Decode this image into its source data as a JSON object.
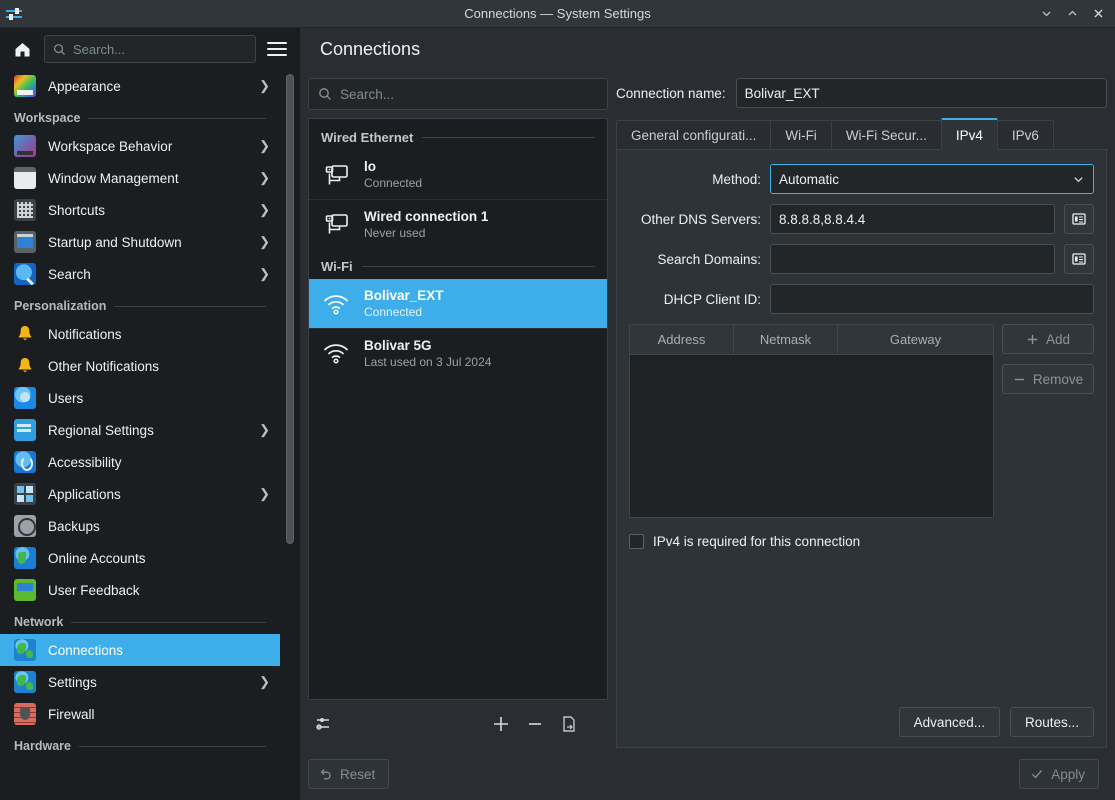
{
  "window": {
    "title": "Connections — System Settings",
    "app_icon": "sliders-icon",
    "controls": {
      "minimize": "minimize-icon",
      "maximize": "maximize-icon",
      "close": "close-icon"
    }
  },
  "sidebar": {
    "home_icon": "home-icon",
    "search": {
      "placeholder": "Search...",
      "value": "",
      "icon": "search-icon"
    },
    "menu_icon": "hamburger-menu-icon",
    "top_items": [
      {
        "label": "Appearance",
        "icon": "appearance-icon",
        "chevron": true,
        "iconclass": "ic-appearance"
      }
    ],
    "groups": [
      {
        "title": "Workspace",
        "items": [
          {
            "label": "Workspace Behavior",
            "icon": "workspace-behavior-icon",
            "chevron": true,
            "iconclass": "ic-wsbehavior"
          },
          {
            "label": "Window Management",
            "icon": "window-management-icon",
            "chevron": true,
            "iconclass": "ic-winmgmt"
          },
          {
            "label": "Shortcuts",
            "icon": "shortcuts-icon",
            "chevron": true,
            "iconclass": "ic-shortcuts"
          },
          {
            "label": "Startup and Shutdown",
            "icon": "startup-shutdown-icon",
            "chevron": true,
            "iconclass": "ic-startup"
          },
          {
            "label": "Search",
            "icon": "search-module-icon",
            "chevron": true,
            "iconclass": "ic-search"
          }
        ]
      },
      {
        "title": "Personalization",
        "items": [
          {
            "label": "Notifications",
            "icon": "bell-icon",
            "chevron": false,
            "iconclass": "ic-bell"
          },
          {
            "label": "Other Notifications",
            "icon": "bell-icon",
            "chevron": false,
            "iconclass": "ic-bell"
          },
          {
            "label": "Users",
            "icon": "users-icon",
            "chevron": false,
            "iconclass": "ic-users"
          },
          {
            "label": "Regional Settings",
            "icon": "regional-settings-icon",
            "chevron": true,
            "iconclass": "ic-regional"
          },
          {
            "label": "Accessibility",
            "icon": "accessibility-icon",
            "chevron": false,
            "iconclass": "ic-access"
          },
          {
            "label": "Applications",
            "icon": "applications-icon",
            "chevron": true,
            "iconclass": "ic-apps"
          },
          {
            "label": "Backups",
            "icon": "backups-icon",
            "chevron": false,
            "iconclass": "ic-backups"
          },
          {
            "label": "Online Accounts",
            "icon": "online-accounts-icon",
            "chevron": false,
            "iconclass": "ic-online"
          },
          {
            "label": "User Feedback",
            "icon": "user-feedback-icon",
            "chevron": false,
            "iconclass": "ic-feedback"
          }
        ]
      },
      {
        "title": "Network",
        "items": [
          {
            "label": "Connections",
            "icon": "globe-icon",
            "chevron": false,
            "selected": true,
            "iconclass": "ic-globe"
          },
          {
            "label": "Settings",
            "icon": "globe-icon",
            "chevron": true,
            "iconclass": "ic-globe"
          },
          {
            "label": "Firewall",
            "icon": "firewall-icon",
            "chevron": false,
            "iconclass": "ic-firewall"
          }
        ]
      },
      {
        "title": "Hardware",
        "items": []
      }
    ]
  },
  "page": {
    "title": "Connections"
  },
  "connections_panel": {
    "search": {
      "placeholder": "Search...",
      "value": "",
      "icon": "search-icon"
    },
    "groups": [
      {
        "title": "Wired Ethernet",
        "items": [
          {
            "name": "lo",
            "status": "Connected",
            "icon": "wired-network-icon",
            "selected": false
          },
          {
            "name": "Wired connection 1",
            "status": "Never used",
            "icon": "wired-network-icon",
            "selected": false
          }
        ]
      },
      {
        "title": "Wi-Fi",
        "items": [
          {
            "name": "Bolivar_EXT",
            "status": "Connected",
            "icon": "wifi-icon",
            "selected": true
          },
          {
            "name": "Bolivar  5G",
            "status": "Last used on 3 Jul 2024",
            "icon": "wifi-icon",
            "selected": false
          }
        ]
      }
    ],
    "toolbar": {
      "configure_label": "configure-icon",
      "add_label": "add-icon",
      "remove_label": "remove-icon",
      "export_label": "export-icon"
    }
  },
  "form": {
    "connection_name_label": "Connection name:",
    "connection_name_value": "Bolivar_EXT",
    "tabs": [
      {
        "label": "General configurati...",
        "active": false
      },
      {
        "label": "Wi-Fi",
        "active": false
      },
      {
        "label": "Wi-Fi Secur...",
        "active": false
      },
      {
        "label": "IPv4",
        "active": true
      },
      {
        "label": "IPv6",
        "active": false
      }
    ],
    "fields": {
      "method_label": "Method:",
      "method_value": "Automatic",
      "dns_label": "Other DNS Servers:",
      "dns_value": "8.8.8.8,8.8.4.4",
      "dns_edit_icon": "list-edit-icon",
      "search_domains_label": "Search Domains:",
      "search_domains_value": "",
      "search_domains_edit_icon": "list-edit-icon",
      "dhcp_label": "DHCP Client ID:",
      "dhcp_value": ""
    },
    "address_table": {
      "columns": [
        "Address",
        "Netmask",
        "Gateway"
      ],
      "rows": [],
      "add_label": "Add",
      "add_icon": "plus-icon",
      "remove_label": "Remove",
      "remove_icon": "minus-icon"
    },
    "required_checkbox": {
      "label": "IPv4 is required for this connection",
      "checked": false
    },
    "panel_buttons": [
      {
        "label": "Advanced..."
      },
      {
        "label": "Routes..."
      }
    ]
  },
  "footer": {
    "reset_label": "Reset",
    "reset_icon": "undo-icon",
    "apply_label": "Apply",
    "apply_icon": "check-icon"
  },
  "colors": {
    "accent": "#3daee9",
    "window_bg": "#2a2e32",
    "panel_bg": "#2e3338",
    "sidebar_bg": "#1b1e20",
    "input_bg": "#232629",
    "text": "#eff0f1",
    "muted_text": "#9aa0a5"
  }
}
